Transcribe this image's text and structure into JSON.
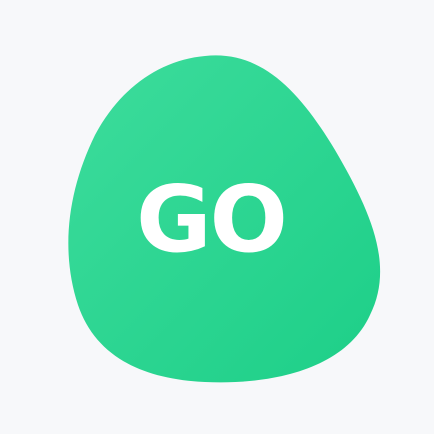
{
  "app_icon": {
    "logo_text": "GO",
    "background_color": "#f7f8fa",
    "blob_color_start": "#3ddb9b",
    "blob_color_end": "#1fd08a",
    "text_color": "#ffffff"
  }
}
